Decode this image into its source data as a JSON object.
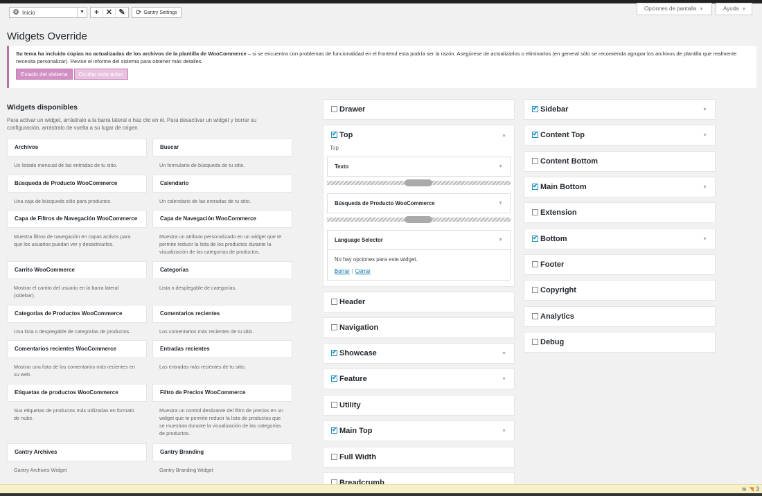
{
  "toolbar": {
    "select_value": "Inicio",
    "gantry_label": "Gantry Settings",
    "gear_icon": "⚙",
    "plus_icon": "+",
    "close_icon": "✕",
    "edit_icon": "✎",
    "refresh_icon": "⟳"
  },
  "screen_options_label": "Opciones de pantalla",
  "help_label": "Ayuda",
  "page_title": "Widgets Override",
  "notice": {
    "bold": "Su tema ha incluido copias no actualizadas de los archivos de la plantilla de WooCommerce",
    "rest": " – si se encuentra con problemas de funcionalidad en el frontend esta podría ser la razón. Asegúrese de actualizarlos o eliminarlos (en general sólo se recomienda agrupar los archivos de plantilla que realmente necesita personalizar). Revise el informe del sistema para obtener más detalles.",
    "btn_status": "Estado del sistema",
    "btn_hide": "Ocultar este aviso",
    "accent": "#b574a6"
  },
  "available": {
    "title": "Widgets disponibles",
    "desc": "Para activar un widget, arrástralo a la barra lateral o haz clic en él. Para desactivar un widget y borrar su configuración, arrástralo de vuelta a su lugar de origen.",
    "widgets": [
      {
        "name": "Archivos",
        "desc": "Un listado mensual de las entradas de tu sitio."
      },
      {
        "name": "Buscar",
        "desc": "Un formulario de búsqueda de tu sitio."
      },
      {
        "name": "Búsqueda de Producto WooCommerce",
        "desc": "Una caja de búsqueda sólo para productos."
      },
      {
        "name": "Calendario",
        "desc": "Un calendario de las entradas de tu sitio."
      },
      {
        "name": "Capa de Filtros de Navegación WooCommerce",
        "desc": "Muestra filtros de navegación en capas activos para que los usuarios puedan ver y desactivarlos."
      },
      {
        "name": "Capa de Navegación WooCommerce",
        "desc": "Muestra un atributo personalizado en un widget que te permite reducir la lista de los productos durante la visualización de las categorías de productos."
      },
      {
        "name": "Carrito WooCommerce",
        "desc": "Mostrar el carrito del usuario en la barra lateral (sidebar)."
      },
      {
        "name": "Categorías",
        "desc": "Lista o desplegable de categorías."
      },
      {
        "name": "Categorías de Productos WooCommerce",
        "desc": "Una lista o desplegable de categorías de productos."
      },
      {
        "name": "Comentarios recientes",
        "desc": "Los comentarios más recientes de tu sitio."
      },
      {
        "name": "Comentarios recientes WooCommerce",
        "desc": "Mostrar una lista de los comentarios más recientes en su web."
      },
      {
        "name": "Entradas recientes",
        "desc": "Las entradas más recientes de tu sitio."
      },
      {
        "name": "Etiquetas de productos WooCommerce",
        "desc": "Sus etiquetas de productos más utilizadas en formato de nube."
      },
      {
        "name": "Filtro de Precios WooCommerce",
        "desc": "Muestra un control deslizante del filtro de precios en un widget que te permite reducir la lista de productos que se muestran durante la visualización de las categorías de productos."
      },
      {
        "name": "Gantry Archives",
        "desc": "Gantry Archives Widget"
      },
      {
        "name": "Gantry Branding",
        "desc": "Gantry Branding Widget"
      }
    ]
  },
  "sidebars_col1": [
    {
      "name": "Drawer",
      "checked": false,
      "expanded": false,
      "has_toggle": false
    },
    {
      "name": "Top",
      "checked": true,
      "expanded": true,
      "has_toggle": true,
      "subtitle": "Top"
    },
    {
      "name": "Header",
      "checked": false,
      "has_toggle": false
    },
    {
      "name": "Navigation",
      "checked": false,
      "has_toggle": false
    },
    {
      "name": "Showcase",
      "checked": true,
      "has_toggle": true
    },
    {
      "name": "Feature",
      "checked": true,
      "has_toggle": true
    },
    {
      "name": "Utility",
      "checked": false,
      "has_toggle": false
    },
    {
      "name": "Main Top",
      "checked": true,
      "has_toggle": true
    },
    {
      "name": "Full Width",
      "checked": false,
      "has_toggle": false
    },
    {
      "name": "Breadcrumb",
      "checked": false,
      "has_toggle": false
    }
  ],
  "top_widgets": [
    {
      "name": "Texto"
    },
    {
      "name": "Búsqueda de Producto WooCommerce"
    },
    {
      "name": "Language Selector",
      "open": true,
      "content": "No hay opciones para este widget.",
      "link_delete": "Borrar",
      "separator": "|",
      "link_close": "Cerrar"
    }
  ],
  "sidebars_col2": [
    {
      "name": "Sidebar",
      "checked": true,
      "has_toggle": true
    },
    {
      "name": "Content Top",
      "checked": true,
      "has_toggle": true
    },
    {
      "name": "Content Bottom",
      "checked": false,
      "has_toggle": false
    },
    {
      "name": "Main Bottom",
      "checked": true,
      "has_toggle": true
    },
    {
      "name": "Extension",
      "checked": false,
      "has_toggle": false
    },
    {
      "name": "Bottom",
      "checked": true,
      "has_toggle": true
    },
    {
      "name": "Footer",
      "checked": false,
      "has_toggle": false
    },
    {
      "name": "Copyright",
      "checked": false,
      "has_toggle": false
    },
    {
      "name": "Analytics",
      "checked": false,
      "has_toggle": false
    },
    {
      "name": "Debug",
      "checked": false,
      "has_toggle": false
    }
  ],
  "toggle_down": "▼",
  "toggle_up": "▲",
  "status_icons": [
    "layers-icon",
    "rss-icon"
  ],
  "status_tail": "3"
}
